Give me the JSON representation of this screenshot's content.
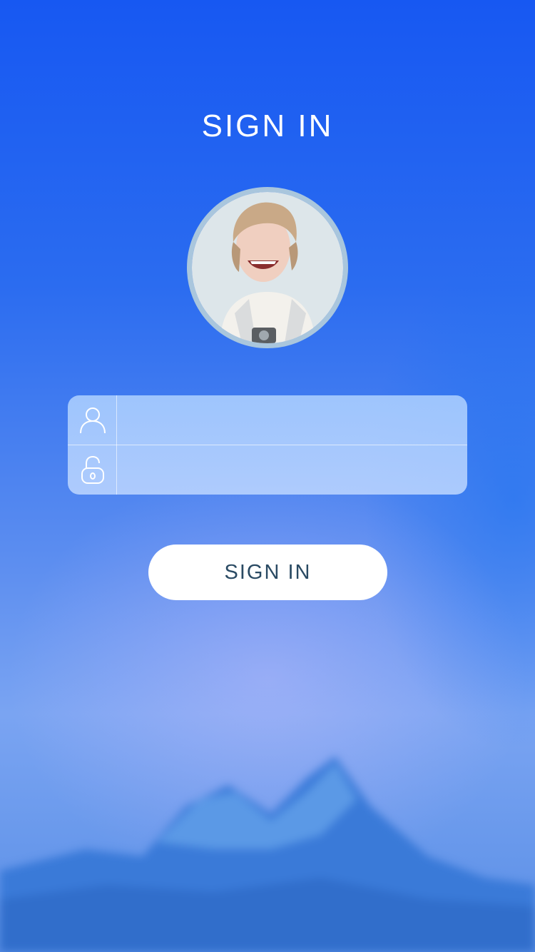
{
  "header": {
    "title": "SIGN IN"
  },
  "form": {
    "username": {
      "icon": "user-icon",
      "value": "",
      "placeholder": ""
    },
    "password": {
      "icon": "lock-icon",
      "value": "",
      "placeholder": ""
    }
  },
  "actions": {
    "signin_label": "SIGN IN"
  },
  "colors": {
    "background_top": "#1758f2",
    "background_bottom": "#7aa4f2",
    "button_bg": "#ffffff",
    "button_text": "#2a4a63",
    "avatar_border": "#a9c6dd"
  }
}
